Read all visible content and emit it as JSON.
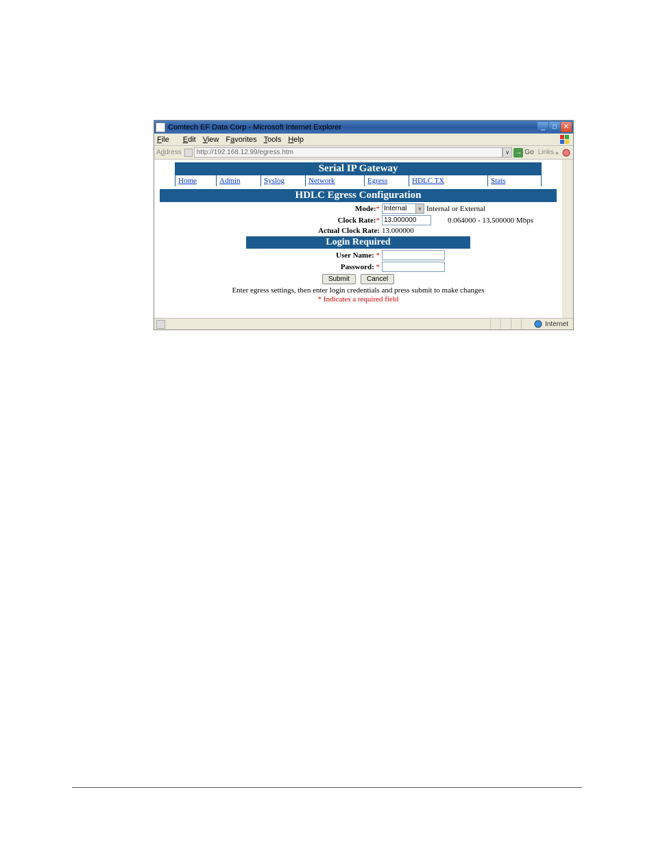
{
  "window": {
    "title": "Comtech EF Data Corp - Microsoft Internet Explorer"
  },
  "menu": {
    "file": "File",
    "edit": "Edit",
    "view": "View",
    "favorites": "Favorites",
    "tools": "Tools",
    "help": "Help"
  },
  "address": {
    "label": "Address",
    "url": "http://192.168.12.99/egress.htm",
    "go": "Go",
    "links": "Links"
  },
  "page": {
    "title": "Serial IP Gateway",
    "nav": {
      "home": "Home",
      "admin": "Admin",
      "syslog": "Syslog",
      "network": "Network",
      "egress": "Egress",
      "hdlctx": "HDLC TX",
      "stats": "Stats"
    },
    "section1": "HDLC Egress Configuration",
    "mode": {
      "label": "Mode:",
      "star": "*",
      "value": "Internal",
      "hint": "Internal or External"
    },
    "clock_rate": {
      "label": "Clock Rate:",
      "star": "*",
      "value": "13.000000",
      "hint": "0.064000 - 13.500000 Mbps"
    },
    "actual_clock_rate": {
      "label": "Actual Clock Rate:",
      "value": "13.000000"
    },
    "section2": "Login Required",
    "username": {
      "label": "User Name:",
      "star": "*"
    },
    "password": {
      "label": "Password:",
      "star": "*"
    },
    "submit": "Submit",
    "cancel": "Cancel",
    "instruction": "Enter egress settings, then enter login credentials and press submit to make changes",
    "required_note": "* Indicates a required field"
  },
  "status": {
    "zone": "Internet"
  }
}
